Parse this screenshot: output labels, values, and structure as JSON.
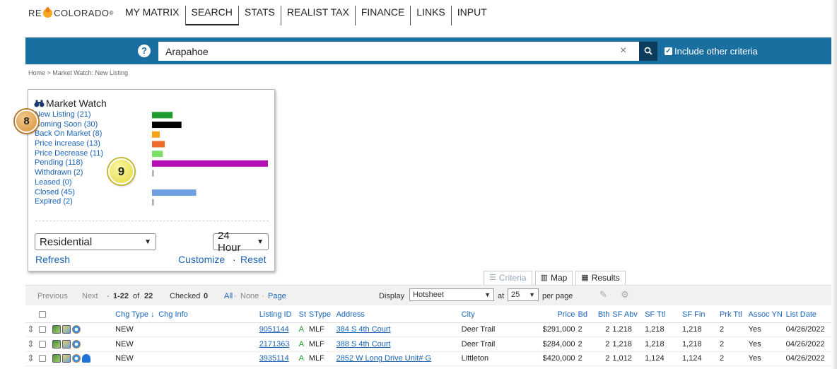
{
  "logo": {
    "text_before": "RE",
    "text_after": "COLORADO",
    "reg": "®"
  },
  "nav": [
    "MY MATRIX",
    "SEARCH",
    "STATS",
    "REALIST TAX",
    "FINANCE",
    "LINKS",
    "INPUT"
  ],
  "search": {
    "help": "?",
    "value": "Arapahoe",
    "clear": "×",
    "include_label": "Include other criteria",
    "include_checked": true
  },
  "breadcrumb": "Home > Market Watch: New Listing",
  "market_watch": {
    "title": "Market Watch",
    "items": [
      {
        "label": "New Listing (21)",
        "count": 21,
        "color": "#1e9a2e"
      },
      {
        "label": "Coming Soon (30)",
        "count": 30,
        "color": "#000000"
      },
      {
        "label": "Back On Market (8)",
        "count": 8,
        "color": "#f5a318"
      },
      {
        "label": "Price Increase (13)",
        "count": 13,
        "color": "#f0682a"
      },
      {
        "label": "Price Decrease (11)",
        "count": 11,
        "color": "#7ee06a"
      },
      {
        "label": "Pending (118)",
        "count": 118,
        "color": "#b510b5"
      },
      {
        "label": "Withdrawn (2)",
        "count": 2,
        "color": "#b0b0b0"
      },
      {
        "label": "Leased (0)",
        "count": 0,
        "color": "#b0b0b0"
      },
      {
        "label": "Closed (45)",
        "count": 45,
        "color": "#6f9fe0"
      },
      {
        "label": "Expired (2)",
        "count": 2,
        "color": "#b0b0b0"
      }
    ],
    "property_type": "Residential",
    "timeframe": "24 Hour",
    "refresh": "Refresh",
    "customize": "Customize",
    "sep": "·",
    "reset": "Reset"
  },
  "badges": {
    "b8": "8",
    "b9": "9"
  },
  "tabs": {
    "criteria": "Criteria",
    "map": "Map",
    "results": "Results"
  },
  "toolbar": {
    "previous": "Previous",
    "next": "Next",
    "range_dot": "·",
    "range": "1-22",
    "of": "of",
    "total": "22",
    "checked_label": "Checked",
    "checked_count": "0",
    "all": "All",
    "none": "None",
    "page": "Page",
    "display_label": "Display",
    "display_value": "Hotsheet",
    "at": "at",
    "per_page_value": "25",
    "per_page": "per page"
  },
  "table": {
    "headers": {
      "chg_type": "Chg Type",
      "chg_info": "Chg Info",
      "listing_id": "Listing ID",
      "st": "St",
      "stype": "SType",
      "address": "Address",
      "city": "City",
      "price": "Price",
      "bd": "Bd",
      "bth": "Bth",
      "sf_abv": "SF Abv",
      "sf_ttl": "SF Ttl",
      "sf_fin": "SF Fin",
      "prk_ttl": "Prk Ttl",
      "assoc_yn": "Assoc YN",
      "list_date": "List Date"
    },
    "rows": [
      {
        "chg_type": "NEW",
        "listing_id": "9051144",
        "st": "A",
        "stype": "MLF",
        "address": "384 S 4th Court",
        "city": "Deer Trail",
        "price": "$291,000",
        "bd": "2",
        "bth": "2",
        "sf_abv": "1,218",
        "sf_ttl": "1,218",
        "sf_fin": "1,218",
        "prk_ttl": "2",
        "assoc_yn": "Yes",
        "list_date": "04/26/2022",
        "agent_icon": false
      },
      {
        "chg_type": "NEW",
        "listing_id": "2171363",
        "st": "A",
        "stype": "MLF",
        "address": "388 S 4th Court",
        "city": "Deer Trail",
        "price": "$284,000",
        "bd": "2",
        "bth": "2",
        "sf_abv": "1,218",
        "sf_ttl": "1,218",
        "sf_fin": "1,218",
        "prk_ttl": "2",
        "assoc_yn": "Yes",
        "list_date": "04/26/2022",
        "agent_icon": false
      },
      {
        "chg_type": "NEW",
        "listing_id": "3935114",
        "st": "A",
        "stype": "MLF",
        "address": "2852 W Long Drive Unit# G",
        "city": "Littleton",
        "price": "$420,000",
        "bd": "2",
        "bth": "2",
        "sf_abv": "1,012",
        "sf_ttl": "1,124",
        "sf_fin": "1,124",
        "prk_ttl": "2",
        "assoc_yn": "Yes",
        "list_date": "04/26/2022",
        "agent_icon": true
      }
    ]
  }
}
